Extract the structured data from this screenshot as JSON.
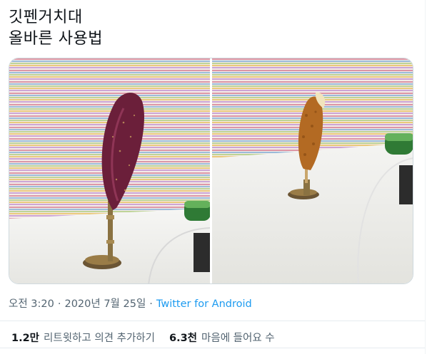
{
  "tweet": {
    "text_lines": [
      "깃펜거치대",
      "올바른 사용법"
    ],
    "time": "오전 3:20",
    "date": "2020년 7월 25일",
    "separator": "·",
    "source": "Twitter for Android"
  },
  "stats": {
    "retweets_count": "1.2만",
    "retweets_label": "리트윗하고 의견 추가하기",
    "likes_count": "6.3천",
    "likes_label": "마음에 들어요 수"
  },
  "colors": {
    "text": "#0f1419",
    "secondary": "#536471",
    "link": "#1d9bf0",
    "border": "#cfd9de"
  }
}
